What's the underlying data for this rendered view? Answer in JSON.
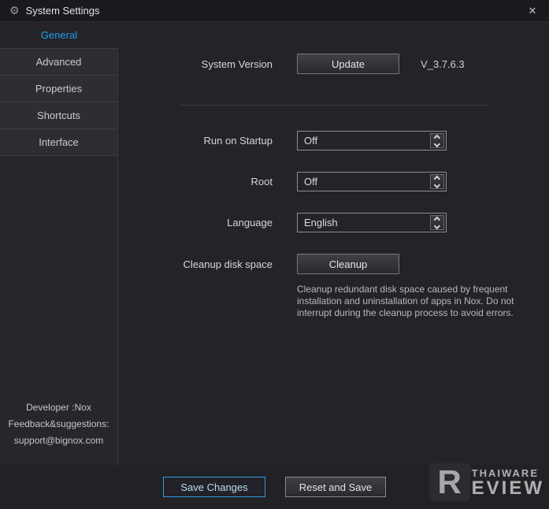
{
  "window": {
    "title": "System Settings"
  },
  "icons": {
    "gear": "⚙",
    "close": "✕"
  },
  "sidebar": {
    "tabs": [
      {
        "label": "General",
        "selected": true
      },
      {
        "label": "Advanced",
        "selected": false
      },
      {
        "label": "Properties",
        "selected": false
      },
      {
        "label": "Shortcuts",
        "selected": false
      },
      {
        "label": "Interface",
        "selected": false
      }
    ],
    "footer": {
      "line1": "Developer :Nox",
      "line2": "Feedback&suggestions:",
      "line3": "support@bignox.com"
    }
  },
  "content": {
    "system_version": {
      "label": "System Version",
      "button_label": "Update",
      "version": "V_3.7.6.3"
    },
    "run_on_startup": {
      "label": "Run on Startup",
      "value": "Off"
    },
    "root": {
      "label": "Root",
      "value": "Off"
    },
    "language": {
      "label": "Language",
      "value": "English"
    },
    "cleanup": {
      "label": "Cleanup disk space",
      "button_label": "Cleanup",
      "description": "Cleanup redundant disk space caused by frequent installation and uninstallation of apps in Nox. Do not interrupt during the cleanup process to avoid errors."
    }
  },
  "footer": {
    "save_label": "Save Changes",
    "reset_label": "Reset and Save"
  },
  "watermark": {
    "letter": "R",
    "top": "THAIWARE",
    "bottom": "EVIEW"
  },
  "colors": {
    "accent": "#1d9dee"
  }
}
